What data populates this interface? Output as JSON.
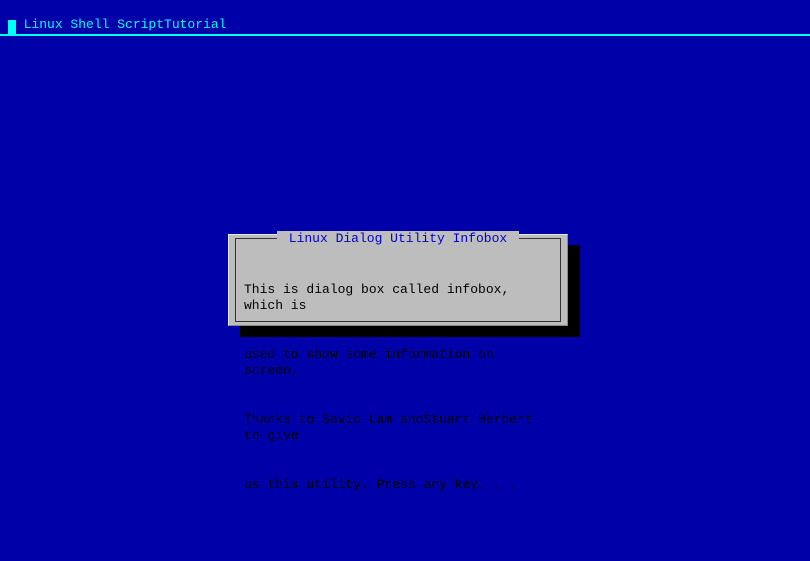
{
  "header": {
    "title": "Linux Shell ScriptTutorial"
  },
  "dialog": {
    "title": " Linux Dialog Utility Infobox ",
    "line1": "This is dialog box called infobox, which is",
    "line2": "used to show some information on screen,",
    "line3": "Thanks to Savio Lam andStuart Herbert to give",
    "line4": "us this utility. Press any key. . ."
  }
}
